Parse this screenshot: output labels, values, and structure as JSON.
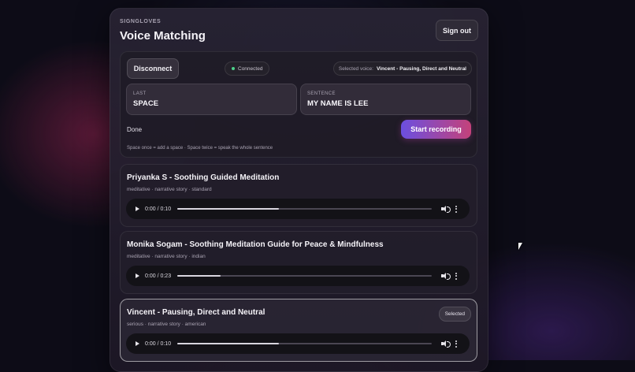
{
  "header": {
    "brand": "SIGNGLOVES",
    "title": "Voice Matching",
    "sign_out_label": "Sign out"
  },
  "control": {
    "disconnect_label": "Disconnect",
    "status_text": "Connected",
    "selected_voice_label": "Selected voice:",
    "selected_voice_value": "Vincent - Pausing, Direct and Neutral",
    "last": {
      "label": "LAST",
      "value": "SPACE"
    },
    "sentence": {
      "label": "SENTENCE",
      "value": "MY NAME IS LEE"
    },
    "state_text": "Done",
    "record_label": "Start recording",
    "hint": "Space once = add a space · Space twice = speak the whole sentence"
  },
  "voices": [
    {
      "name": "Priyanka S - Soothing Guided Meditation",
      "tags": "meditative · narrative story · standard",
      "time": "0:00 / 0:10",
      "progress": 0.4,
      "selected": false,
      "badge": ""
    },
    {
      "name": "Monika Sogam - Soothing Meditation Guide for Peace & Mindfulness",
      "tags": "meditative · narrative story · indian",
      "time": "0:00 / 0:23",
      "progress": 0.17,
      "selected": false,
      "badge": ""
    },
    {
      "name": "Vincent - Pausing, Direct and Neutral",
      "tags": "serious · narrative story · american",
      "time": "0:00 / 0:10",
      "progress": 0.4,
      "selected": true,
      "badge": "Selected"
    }
  ],
  "colors": {
    "accent_gradient_start": "#6b4fe0",
    "accent_gradient_end": "#c4427a",
    "connected_dot": "#4cd08a"
  },
  "icons": {
    "play": "play-icon",
    "volume": "volume-icon",
    "more": "more-vertical-icon",
    "status": "status-dot-icon"
  }
}
